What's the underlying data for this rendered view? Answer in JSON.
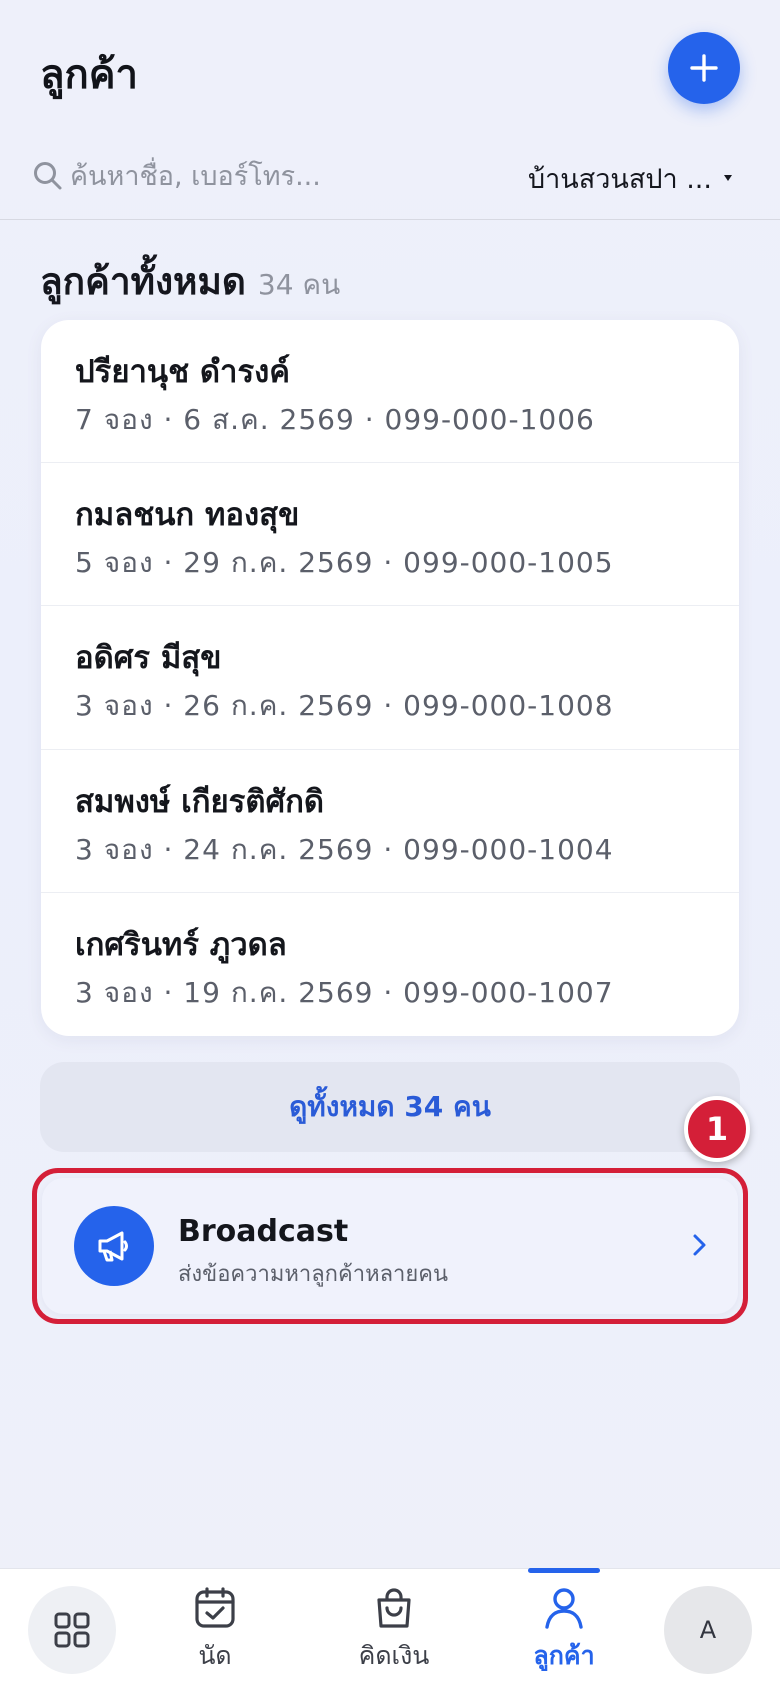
{
  "header": {
    "title": "ลูกค้า",
    "add_icon": "plus-icon"
  },
  "search": {
    "placeholder": "ค้นหาชื่อ, เบอร์โทร...",
    "branch": "บ้านสวนสปา ..."
  },
  "section": {
    "title": "ลูกค้าทั้งหมด",
    "count": "34 คน"
  },
  "customers": [
    {
      "name": "ปรียานุช ดำรงค์",
      "meta": "7 จอง · 6 ส.ค. 2569 · 099-000-1006"
    },
    {
      "name": "กมลชนก ทองสุข",
      "meta": "5 จอง · 29 ก.ค. 2569 · 099-000-1005"
    },
    {
      "name": "อดิศร มีสุข",
      "meta": "3 จอง · 26 ก.ค. 2569 · 099-000-1008"
    },
    {
      "name": "สมพงษ์ เกียรติศักดิ",
      "meta": "3 จอง · 24 ก.ค. 2569 · 099-000-1004"
    },
    {
      "name": "เกศรินทร์ ภูวดล",
      "meta": "3 จอง · 19 ก.ค. 2569 · 099-000-1007"
    }
  ],
  "view_all": {
    "label": "ดูทั้งหมด 34 คน"
  },
  "annotation": {
    "badge": "1"
  },
  "broadcast": {
    "title": "Broadcast",
    "subtitle": "ส่งข้อความหาลูกค้าหลายคน",
    "icon": "megaphone-icon"
  },
  "tabbar": {
    "tabs": [
      {
        "label": "",
        "icon": "grid-icon"
      },
      {
        "label": "นัด",
        "icon": "calendar-check-icon"
      },
      {
        "label": "คิดเงิน",
        "icon": "shopping-bag-icon"
      },
      {
        "label": "ลูกค้า",
        "icon": "person-icon",
        "active": true
      }
    ],
    "avatar": "A"
  },
  "colors": {
    "accent": "#2563eb",
    "highlight": "#d41f38"
  }
}
